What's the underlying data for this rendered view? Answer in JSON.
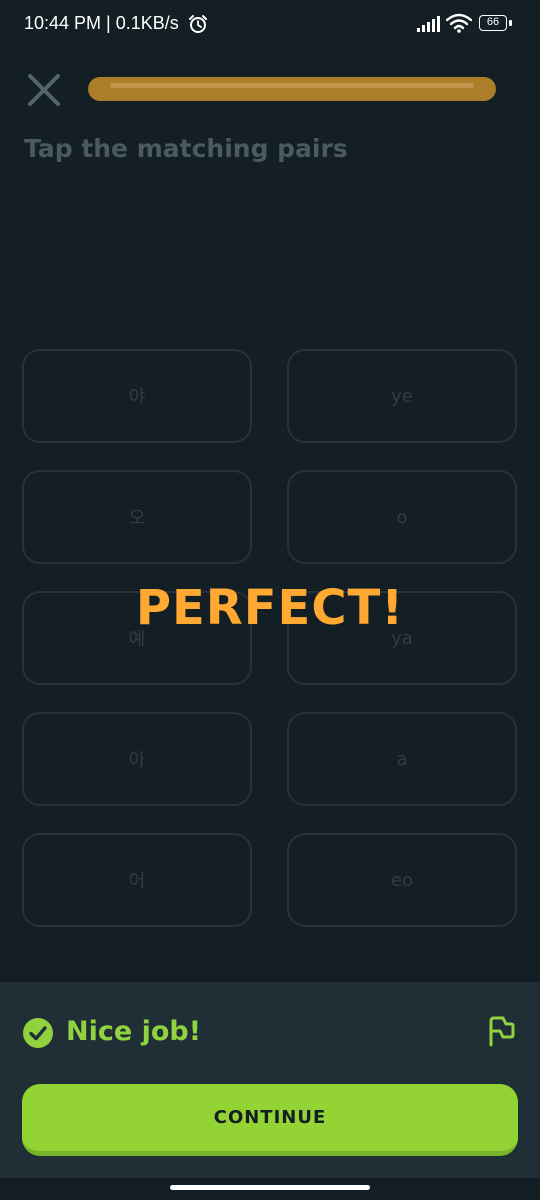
{
  "status_bar": {
    "time": "10:44 PM | 0.1KB/s",
    "battery": "66",
    "icons": [
      "alarm-icon",
      "signal-icon",
      "wifi-icon",
      "battery-icon"
    ]
  },
  "lesson": {
    "progress": 1.0,
    "instruction": "Tap the matching pairs",
    "tiles": [
      {
        "left": "야",
        "right": "ye"
      },
      {
        "left": "오",
        "right": "o"
      },
      {
        "left": "예",
        "right": "ya"
      },
      {
        "left": "아",
        "right": "a"
      },
      {
        "left": "어",
        "right": "eo"
      }
    ],
    "banner": "PERFECT!"
  },
  "feedback": {
    "message": "Nice job!",
    "continue_label": "CONTINUE"
  },
  "colors": {
    "background": "#131f24",
    "progress_fill": "#ad7e29",
    "banner": "#ffa933",
    "success_green": "#90d33f",
    "continue_button": "#93d333",
    "panel": "#202f36"
  }
}
